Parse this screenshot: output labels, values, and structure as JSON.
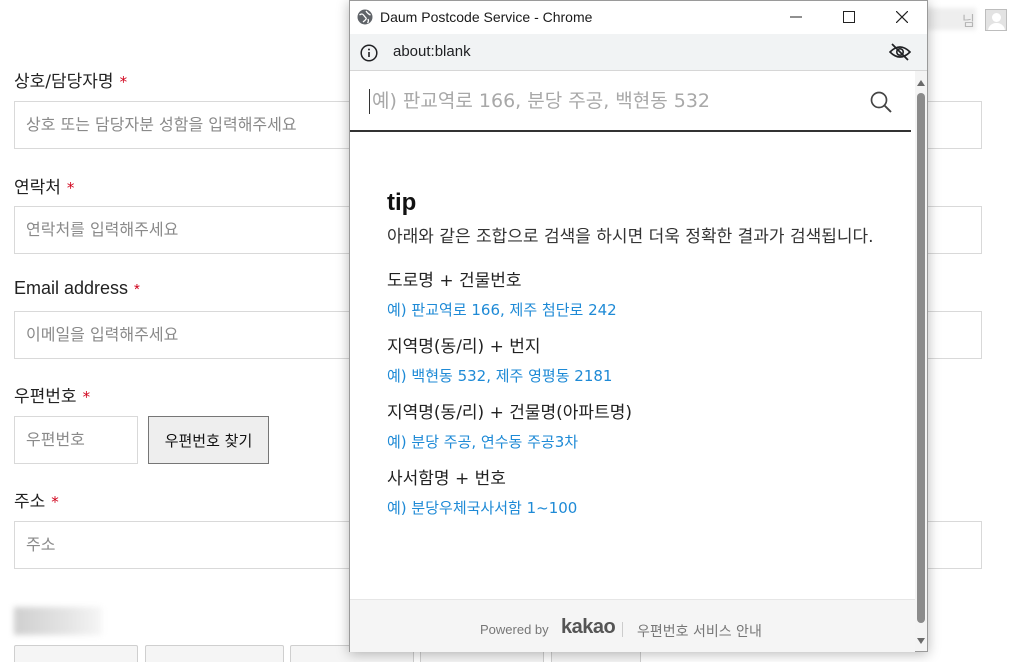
{
  "form": {
    "company_label": "상호/담당자명",
    "company_placeholder": "상호 또는 담당자분 성함을 입력해주세요",
    "phone_label": "연락처",
    "phone_placeholder": "연락처를 입력해주세요",
    "email_label": "Email address",
    "email_placeholder": "이메일을 입력해주세요",
    "zip_label": "우편번호",
    "zip_placeholder": "우편번호",
    "zip_button": "우편번호 찾기",
    "address_label": "주소",
    "address_placeholder": "주소",
    "required_mark": "*"
  },
  "user": {
    "suffix": "님"
  },
  "popup": {
    "window_title": "Daum Postcode Service - Chrome",
    "url": "about:blank",
    "search_placeholder": "예) 판교역로 166, 분당 주공, 백현동 532",
    "tip_title": "tip",
    "tip_desc": "아래와 같은 조합으로 검색을 하시면 더욱 정확한 결과가 검색됩니다.",
    "tips": [
      {
        "head": "도로명 + 건물번호",
        "example": "예) 판교역로 166,  제주 첨단로 242"
      },
      {
        "head": "지역명(동/리) + 번지",
        "example": "예) 백현동 532,  제주 영평동 2181"
      },
      {
        "head": "지역명(동/리) + 건물명(아파트명)",
        "example": "예) 분당 주공,  연수동 주공3차"
      },
      {
        "head": "사서함명 + 번호",
        "example": "예) 분당우체국사서함 1~100"
      }
    ],
    "footer": {
      "powered_by": "Powered by",
      "brand": "kakao",
      "guide": "우편번호 서비스 안내"
    }
  },
  "colors": {
    "accent_link": "#1e8ad6",
    "required": "#d0021b"
  }
}
